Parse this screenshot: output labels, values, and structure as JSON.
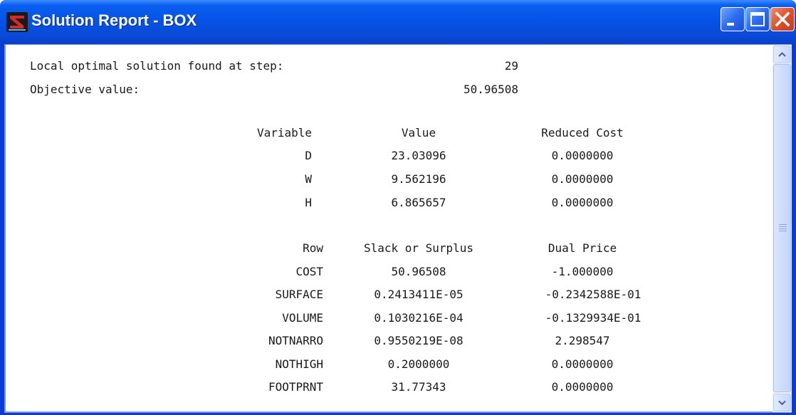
{
  "window": {
    "title": "Solution Report - BOX",
    "icon": "lingo-app-icon",
    "controls": [
      "minimize-icon",
      "maximize-icon",
      "close-icon"
    ]
  },
  "report": {
    "header": {
      "step_label": "Local optimal solution found at step:",
      "step_value": "29",
      "objective_label": "Objective value:",
      "objective_value": "50.96508"
    },
    "variables": {
      "headers": [
        "Variable",
        "Value",
        "Reduced Cost"
      ],
      "rows": [
        [
          "D",
          "23.03096",
          "0.0000000"
        ],
        [
          "W",
          "9.562196",
          "0.0000000"
        ],
        [
          "H",
          "6.865657",
          "0.0000000"
        ]
      ]
    },
    "rows": {
      "headers": [
        "Row",
        "Slack or Surplus",
        "Dual Price"
      ],
      "rows": [
        [
          "COST",
          "50.96508",
          "-1.000000"
        ],
        [
          "SURFACE",
          "0.2413411E-05",
          "-0.2342588E-01"
        ],
        [
          "VOLUME",
          "0.1030216E-04",
          "-0.1329934E-01"
        ],
        [
          "NOTNARRO",
          "0.9550219E-08",
          "2.298547"
        ],
        [
          "NOTHIGH",
          "0.2000000",
          "0.0000000"
        ],
        [
          "FOOTPRNT",
          "31.77343",
          "0.0000000"
        ]
      ]
    }
  },
  "colors": {
    "titlebar": "#0553e6",
    "close_button": "#e0502c",
    "text": "#1a1a1a"
  }
}
